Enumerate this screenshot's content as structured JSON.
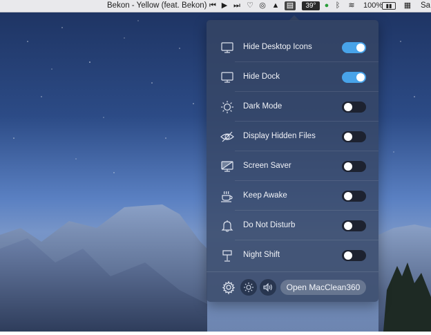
{
  "menubar": {
    "now_playing": "Bekon - Yellow (feat. Bekon)",
    "weather": "39°",
    "battery": "100%",
    "clock_partial": "Sa"
  },
  "panel": {
    "toggles": [
      {
        "label": "Hide Desktop Icons",
        "icon": "monitor-icon",
        "on": true
      },
      {
        "label": "Hide Dock",
        "icon": "monitor-icon",
        "on": true
      },
      {
        "label": "Dark Mode",
        "icon": "sun-icon",
        "on": false
      },
      {
        "label": "Display Hidden Files",
        "icon": "eye-slash-icon",
        "on": false
      },
      {
        "label": "Screen Saver",
        "icon": "screen-saver-icon",
        "on": false
      },
      {
        "label": "Keep Awake",
        "icon": "coffee-cup-icon",
        "on": false
      },
      {
        "label": "Do Not Disturb",
        "icon": "bell-icon",
        "on": false
      },
      {
        "label": "Night Shift",
        "icon": "lamp-icon",
        "on": false
      }
    ],
    "footer": {
      "open_button": "Open MacClean360",
      "icons": [
        "gear-icon",
        "brightness-icon",
        "volume-icon"
      ]
    }
  },
  "colors": {
    "toggle_on": "#48a3e9",
    "toggle_off": "#1d2230",
    "panel_bg": "#374664"
  }
}
